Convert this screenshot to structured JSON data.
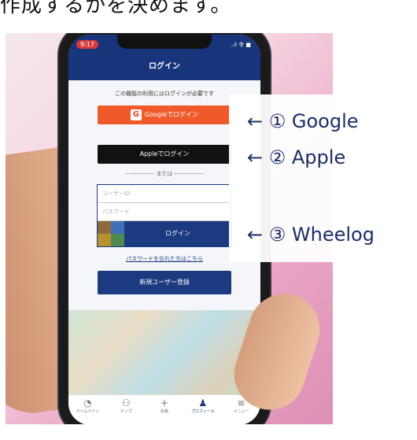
{
  "caption": "作成するかを決めます。",
  "status": {
    "time": "9:17",
    "signal": "..ıl  令  ■"
  },
  "header": {
    "title": "ログイン"
  },
  "notice": "この機能の利用にはログインが必要です",
  "buttons": {
    "google_icon": "G",
    "google_label": "Googleでログイン",
    "apple_label": " Appleでログイン",
    "divider": "--------------- または ---------------",
    "login_label": "ログイン",
    "forgot_label": "パスワードを忘れた方はこちら",
    "register_label": "新規ユーザー登録"
  },
  "form": {
    "user_placeholder": "ユーザーID",
    "pass_placeholder": "パスワード"
  },
  "tabs": [
    {
      "icon": "◔",
      "label": "タイムライン"
    },
    {
      "icon": "⚇",
      "label": "マップ"
    },
    {
      "icon": "+",
      "label": "投稿"
    },
    {
      "icon": "♟",
      "label": "プロフィール"
    },
    {
      "icon": "≡",
      "label": "メニュー"
    }
  ],
  "callouts": {
    "google": "← ① Google",
    "apple": "← ② Apple",
    "wheelog": "← ③ Wheelog"
  },
  "colors": {
    "brand_blue": "#1c3a80",
    "google_orange": "#f05a2a"
  }
}
